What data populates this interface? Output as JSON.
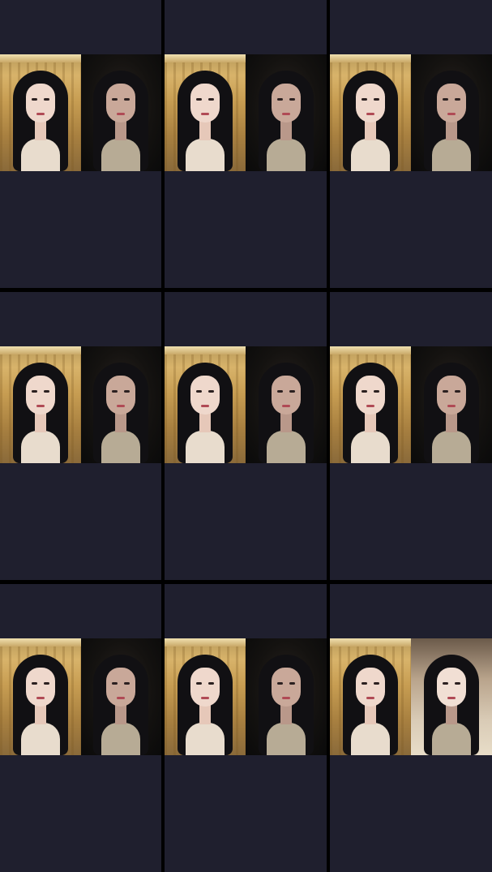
{
  "screen": {
    "background": "#000000",
    "tile_background": "#1f1f2e"
  },
  "call_grid": {
    "rows": 3,
    "columns": 3,
    "tiles": [
      {
        "host_scene": "golden-room",
        "guest_scene": "dark-room"
      },
      {
        "host_scene": "golden-room",
        "guest_scene": "dark-room"
      },
      {
        "host_scene": "golden-room",
        "guest_scene": "dark-room"
      },
      {
        "host_scene": "golden-room",
        "guest_scene": "dark-room"
      },
      {
        "host_scene": "golden-room",
        "guest_scene": "dark-room"
      },
      {
        "host_scene": "golden-room",
        "guest_scene": "dark-room"
      },
      {
        "host_scene": "golden-room",
        "guest_scene": "dark-room"
      },
      {
        "host_scene": "golden-room",
        "guest_scene": "dark-room"
      },
      {
        "host_scene": "golden-room",
        "guest_scene": "light-room"
      }
    ]
  }
}
